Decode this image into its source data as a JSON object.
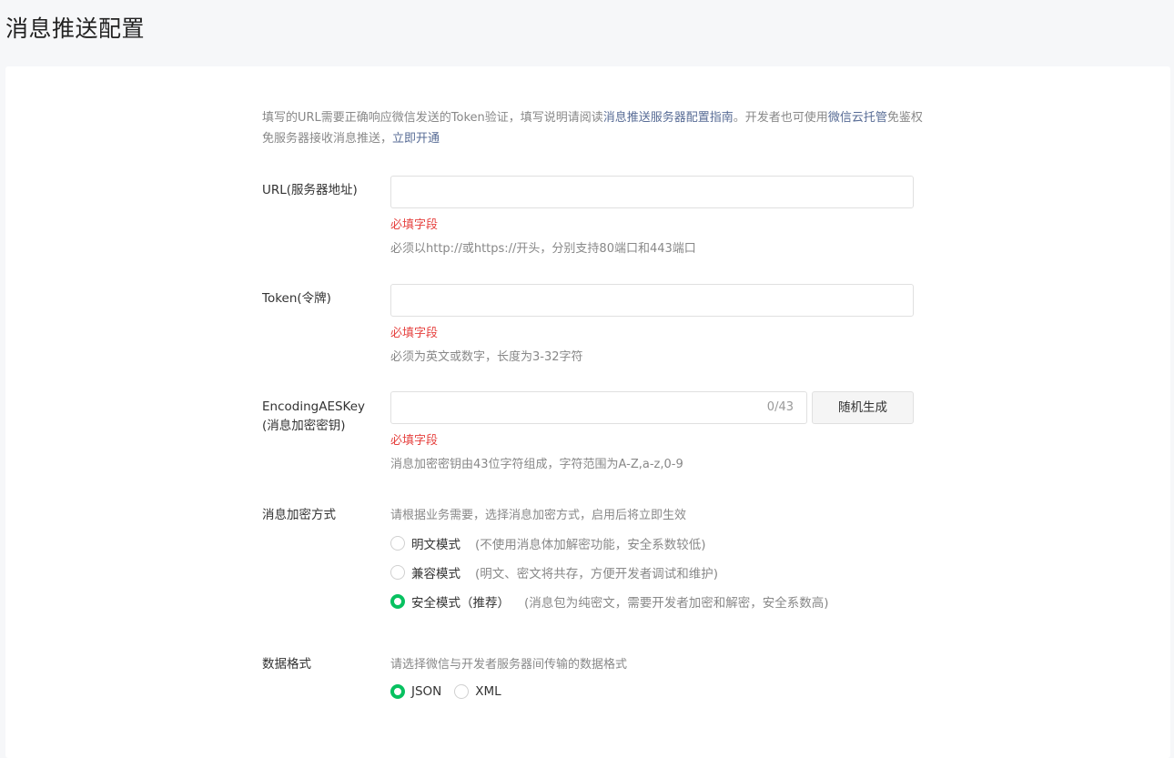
{
  "page": {
    "title": "消息推送配置"
  },
  "intro": {
    "text1": "填写的URL需要正确响应微信发送的Token验证，填写说明请阅读",
    "link1": "消息推送服务器配置指南",
    "text2": "。开发者也可使用",
    "link2": "微信云托管",
    "text3": "免鉴权免服务器接收消息推送，",
    "link3": "立即开通"
  },
  "url_field": {
    "label": "URL(服务器地址)",
    "value": "",
    "error": "必填字段",
    "hint": "必须以http://或https://开头，分别支持80端口和443端口"
  },
  "token_field": {
    "label": "Token(令牌)",
    "value": "",
    "error": "必填字段",
    "hint": "必须为英文或数字，长度为3-32字符"
  },
  "aeskey_field": {
    "label_line1": "EncodingAESKey",
    "label_line2": "(消息加密密钥)",
    "value": "",
    "counter": "0/43",
    "generate_button": "随机生成",
    "error": "必填字段",
    "hint": "消息加密密钥由43位字符组成，字符范围为A-Z,a-z,0-9"
  },
  "encryption": {
    "label": "消息加密方式",
    "hint": "请根据业务需要，选择消息加密方式，启用后将立即生效",
    "options": [
      {
        "label": "明文模式",
        "desc": "(不使用消息体加解密功能，安全系数较低)",
        "checked": false
      },
      {
        "label": "兼容模式",
        "desc": "(明文、密文将共存，方便开发者调试和维护)",
        "checked": false
      },
      {
        "label": "安全模式（推荐）",
        "desc": "(消息包为纯密文，需要开发者加密和解密，安全系数高)",
        "checked": true
      }
    ]
  },
  "data_format": {
    "label": "数据格式",
    "hint": "请选择微信与开发者服务器间传输的数据格式",
    "options": [
      {
        "label": "JSON",
        "checked": true
      },
      {
        "label": "XML",
        "checked": false
      }
    ]
  },
  "colors": {
    "accent_green": "#07c160",
    "error_red": "#e64340",
    "link_blue": "#576b95"
  }
}
